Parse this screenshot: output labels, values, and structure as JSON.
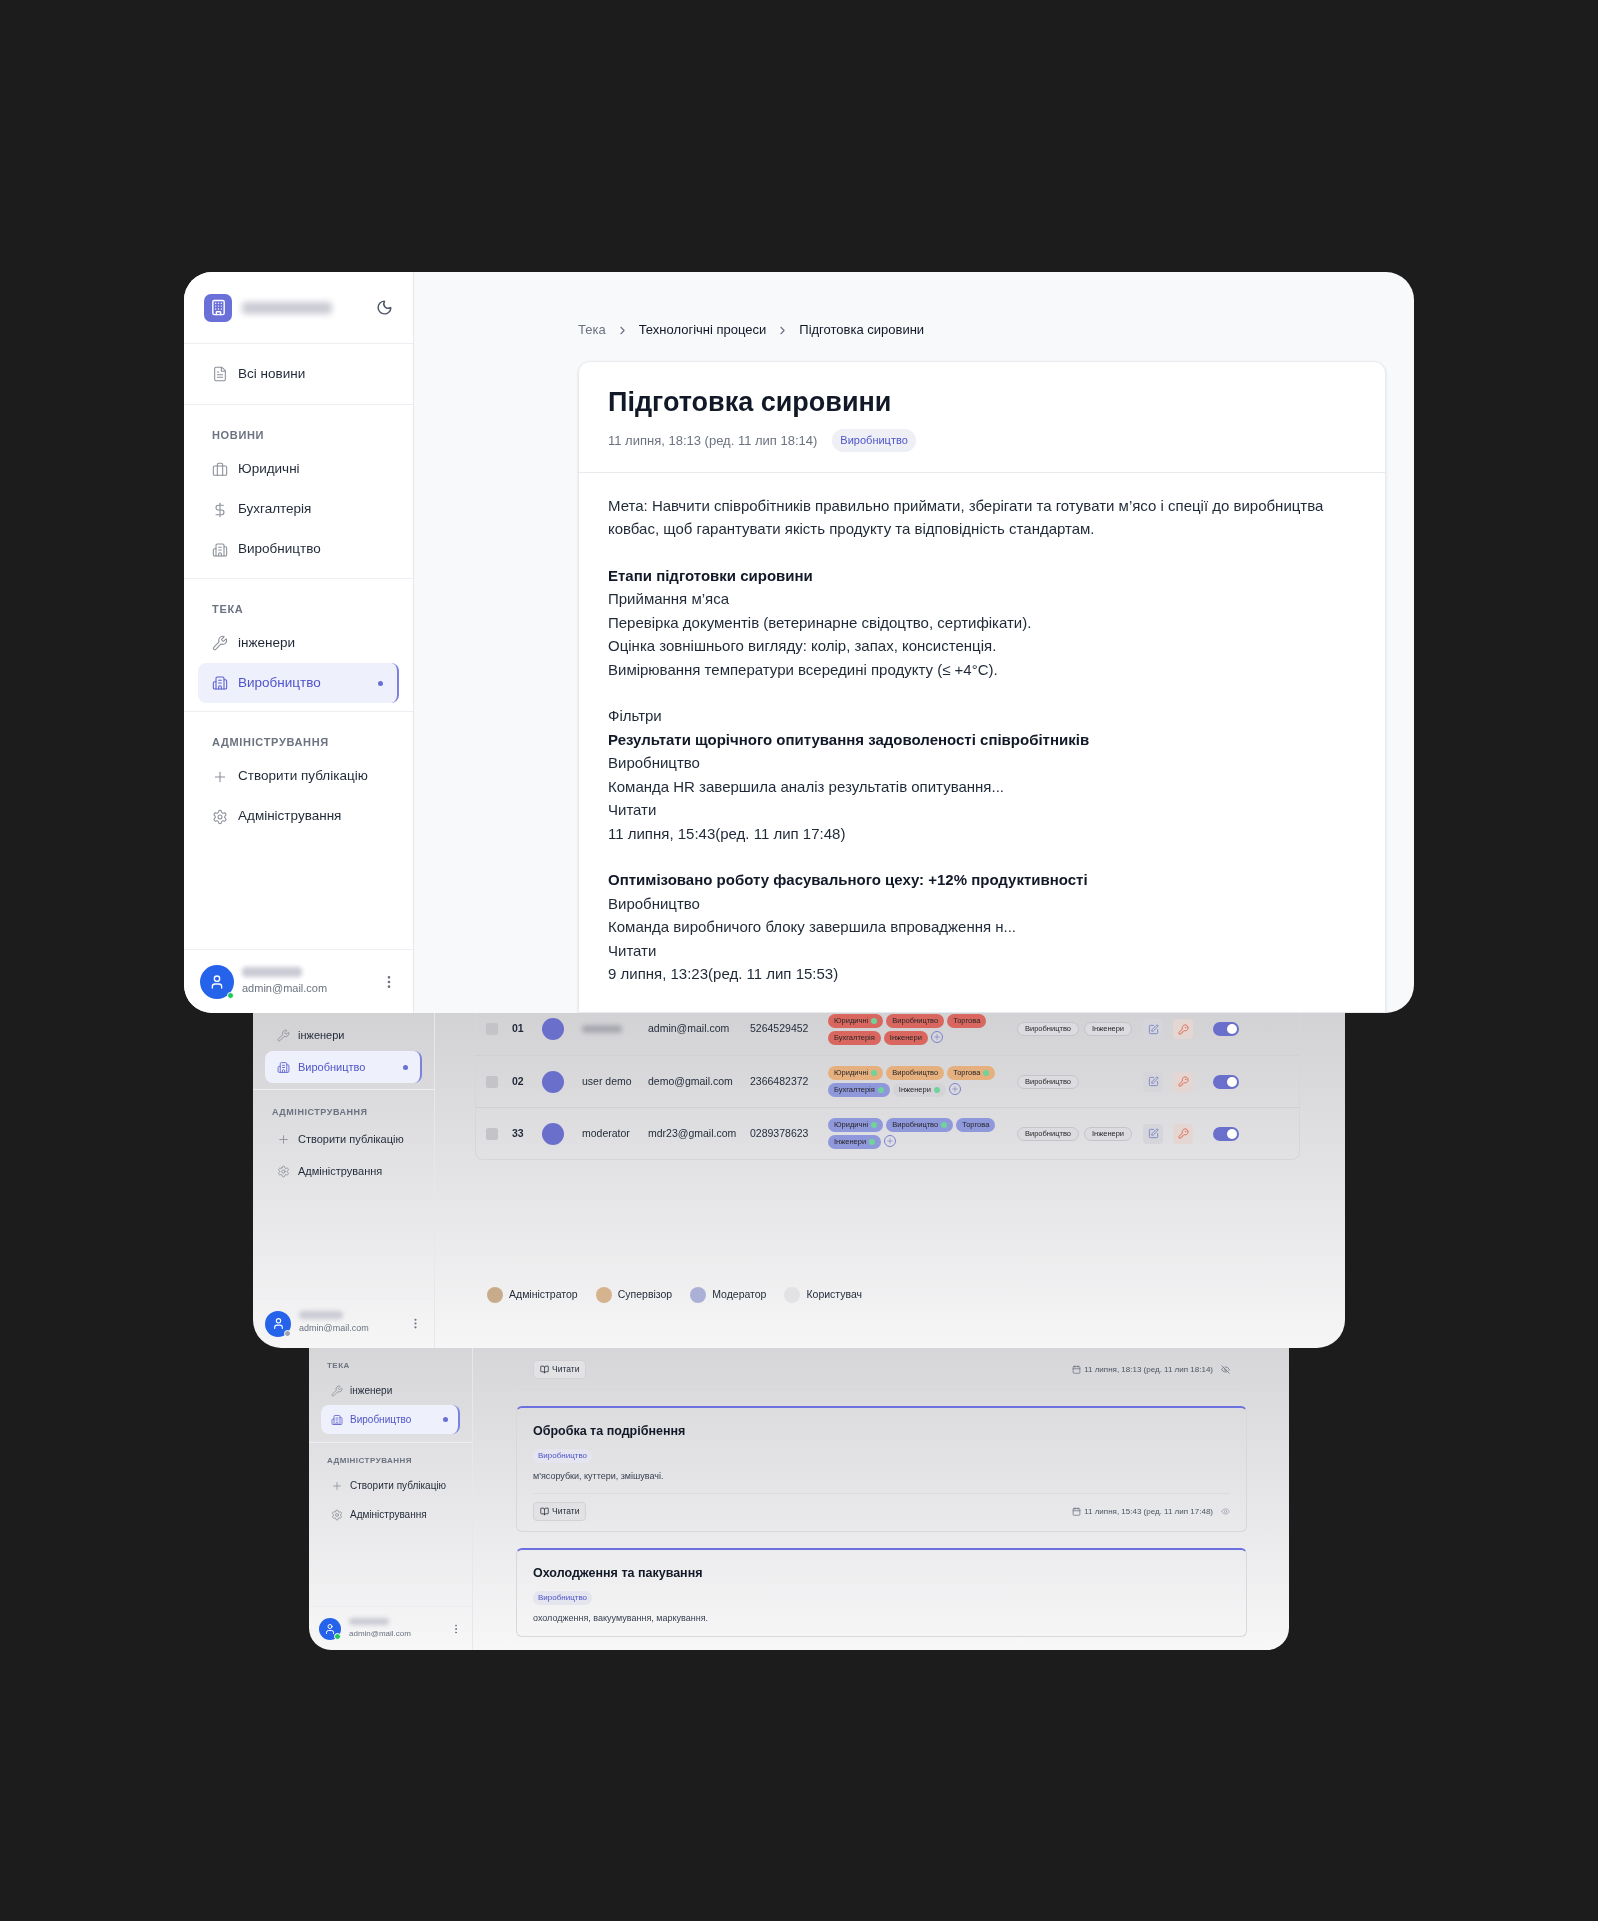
{
  "screens": [
    {
      "kind": "article",
      "sidebar": {
        "sections": [
          {
            "items": [
              {
                "label": "Всі новини",
                "selected": false
              }
            ]
          },
          {
            "title": "НОВИНИ",
            "items": [
              {
                "label": "Юридичні",
                "selected": false
              },
              {
                "label": "Бухгалтерія",
                "selected": false
              },
              {
                "label": "Виробництво",
                "selected": false
              }
            ]
          },
          {
            "title": "ТЕКА",
            "items": [
              {
                "label": "інженери",
                "selected": false
              },
              {
                "label": "Виробництво",
                "selected": true
              }
            ]
          },
          {
            "title": "АДМІНІСТРУВАННЯ",
            "items": [
              {
                "label": "Створити публікацію",
                "selected": false
              },
              {
                "label": "Адміністрування",
                "selected": false
              }
            ]
          }
        ],
        "user": {
          "email": "admin@mail.com",
          "online": true
        }
      },
      "breadcrumb": [
        "Тека",
        "Технологічні процеси",
        "Підготовка сировини"
      ],
      "article": {
        "title": "Підготовка сировини",
        "date": "11 липня, 18:13 (ред. 11 лип 18:14)",
        "tag": "Виробництво",
        "blocks": [
          [
            {
              "text": "Мета: Навчити співробітників правильно приймати, зберігати та готувати м’ясо і спеції до виробництва ковбас, щоб гарантувати якість продукту та відповідність стандартам.",
              "bold": false
            }
          ],
          [
            {
              "text": "Етапи підготовки сировини",
              "bold": true
            },
            {
              "text": "Приймання м’яса",
              "bold": false
            },
            {
              "text": "Перевірка документів (ветеринарне свідоцтво, сертифікати).",
              "bold": false
            },
            {
              "text": "Оцінка зовнішнього вигляду: колір, запах, консистенція.",
              "bold": false
            },
            {
              "text": "Вимірювання температури всередині продукту (≤ +4°C).",
              "bold": false
            }
          ],
          [
            {
              "text": "Фільтри",
              "bold": false
            },
            {
              "text": "Результати щорічного опитування задоволеності співробітників",
              "bold": true
            },
            {
              "text": "Виробництво",
              "bold": false
            },
            {
              "text": "Команда HR завершила аналіз результатів опитування...",
              "bold": false
            },
            {
              "text": "Читати",
              "bold": false
            },
            {
              "text": "11 липня, 15:43(ред. 11 лип 17:48)",
              "bold": false
            }
          ],
          [
            {
              "text": "Оптимізовано роботу фасувального цеху: +12% продуктивності",
              "bold": true
            },
            {
              "text": "Виробництво",
              "bold": false
            },
            {
              "text": "Команда виробничого блоку завершила впровадження н...",
              "bold": false
            },
            {
              "text": "Читати",
              "bold": false
            },
            {
              "text": "9 липня, 13:23(ред. 11 лип 15:53)",
              "bold": false
            }
          ]
        ]
      }
    },
    {
      "kind": "users",
      "sidebar": {
        "sections": [
          {
            "items": [
              {
                "label": "інженери",
                "selected": false
              },
              {
                "label": "Виробництво",
                "selected": true
              }
            ]
          },
          {
            "title": "АДМІНІСТРУВАННЯ",
            "items": [
              {
                "label": "Створити публікацію",
                "selected": false
              },
              {
                "label": "Адміністрування",
                "selected": false
              }
            ]
          }
        ],
        "user": {
          "email": "admin@mail.com",
          "online": false
        }
      },
      "rows": [
        {
          "number": "01",
          "checked": false,
          "email": "admin@mail.com",
          "phone": "5264529452",
          "on": true,
          "tags": [
            {
              "label": "Юридичні",
              "color": "#d9675f",
              "dot": true
            },
            {
              "label": "Виробництво",
              "color": "#d9675f",
              "dot": false
            },
            {
              "label": "Торгова",
              "color": "#d9675f",
              "dot": false
            },
            {
              "label": "Бухгалтерія",
              "color": "#d9675f",
              "dot": false
            },
            {
              "label": "Інженери",
              "color": "#d9675f",
              "dot": false
            }
          ],
          "departments": [
            "Виробництво",
            "Інженери"
          ]
        },
        {
          "number": "02",
          "checked": false,
          "name": "user demo",
          "email": "demo@gmail.com",
          "phone": "2366482372",
          "on": true,
          "tags": [
            {
              "label": "Юридичні",
              "color": "#e6b07e",
              "dot": true
            },
            {
              "label": "Виробництво",
              "color": "#e6b07e",
              "dot": false
            },
            {
              "label": "Торгова",
              "color": "#e6b07e",
              "dot": true
            },
            {
              "label": "Бухгалтерія",
              "color": "#8f98db",
              "dot": true
            },
            {
              "label": "Інженери",
              "color": "#d4d4d8",
              "dot": true
            }
          ],
          "departments": [
            "Виробництво"
          ]
        },
        {
          "number": "33",
          "checked": false,
          "name": "moderator",
          "email": "mdr23@gmail.com",
          "phone": "0289378623",
          "on": true,
          "tags": [
            {
              "label": "Юридичні",
              "color": "#8f98db",
              "dot": true
            },
            {
              "label": "Виробництво",
              "color": "#8f98db",
              "dot": true
            },
            {
              "label": "Торгова",
              "color": "#8f98db",
              "dot": false
            },
            {
              "label": "Інженери",
              "color": "#8f98db",
              "dot": true
            }
          ],
          "departments": [
            "Виробництво",
            "Інженери"
          ]
        }
      ],
      "legend": [
        {
          "label": "Адміністратор",
          "color": "#c8ab8a"
        },
        {
          "label": "Супервізор",
          "color": "#d6b38f"
        },
        {
          "label": "Модератор",
          "color": "#aab0d6"
        },
        {
          "label": "Користувач",
          "color": "#e2e2e4"
        }
      ]
    },
    {
      "kind": "feed",
      "sidebar": {
        "sections": [
          {
            "title": "ТЕКА",
            "items": [
              {
                "label": "інженери",
                "selected": false
              },
              {
                "label": "Виробництво",
                "selected": true
              }
            ]
          },
          {
            "title": "АДМІНІСТРУВАННЯ",
            "items": [
              {
                "label": "Створити публікацію",
                "selected": false
              },
              {
                "label": "Адміністрування",
                "selected": false
              }
            ]
          }
        ],
        "user": {
          "email": "admin@mail.com",
          "online": true
        }
      },
      "posts": [
        {
          "read": "Читати",
          "date": "11 липня, 18:13 (ред. 11 лип 18:14)",
          "hidden": true
        },
        {
          "title": "Обробка та подрібнення",
          "tag": "Виробництво",
          "text": "м'ясорубки, куттери, змішувачі.",
          "read": "Читати",
          "date": "11 липня, 15:43 (ред. 11 лип 17:48)",
          "hidden": false
        },
        {
          "title": "Охолодження та пакування",
          "tag": "Виробництво",
          "text": "охолодження, вакуумування, маркування."
        }
      ]
    }
  ]
}
